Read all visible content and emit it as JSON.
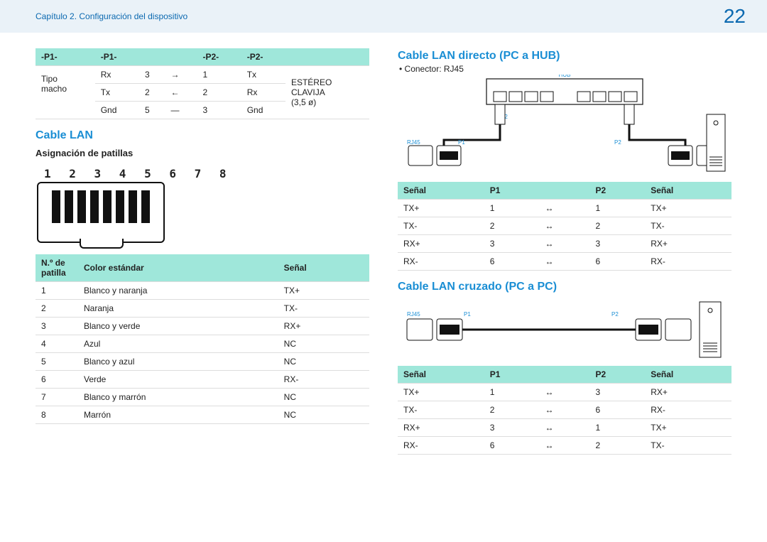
{
  "header": {
    "chapter": "Capítulo 2. Configuración del dispositivo",
    "page": "22"
  },
  "table1": {
    "headers": [
      "-P1-",
      "-P1-",
      "",
      "-P2-",
      "-P2-"
    ],
    "rows": [
      [
        "Tipo",
        "Rx",
        "3",
        "→",
        "1",
        "Tx",
        "ESTÉREO"
      ],
      [
        "macho",
        "Tx",
        "2",
        "←",
        "2",
        "Rx",
        "CLAVIJA"
      ],
      [
        "",
        "Gnd",
        "5",
        "—",
        "3",
        "Gnd",
        "(3,5 ø)"
      ]
    ]
  },
  "left": {
    "section": "Cable LAN",
    "subtitle": "Asignación de patillas",
    "pins": "1 2 3 4 5 6 7 8",
    "pinTable": {
      "headers": [
        "N.º de patilla",
        "Color estándar",
        "Señal"
      ],
      "rows": [
        [
          "1",
          "Blanco y naranja",
          "TX+"
        ],
        [
          "2",
          "Naranja",
          "TX-"
        ],
        [
          "3",
          "Blanco y verde",
          "RX+"
        ],
        [
          "4",
          "Azul",
          "NC"
        ],
        [
          "5",
          "Blanco y azul",
          "NC"
        ],
        [
          "6",
          "Verde",
          "RX-"
        ],
        [
          "7",
          "Blanco y marrón",
          "NC"
        ],
        [
          "8",
          "Marrón",
          "NC"
        ]
      ]
    }
  },
  "right": {
    "direct": {
      "title": "Cable LAN directo (PC a HUB)",
      "bullet": "•  Conector: RJ45",
      "labels": {
        "hub": "HUB",
        "p1": "P1",
        "p2": "P2",
        "rj45": "RJ45"
      },
      "tableHeaders": [
        "Señal",
        "P1",
        "",
        "P2",
        "Señal"
      ],
      "rows": [
        [
          "TX+",
          "1",
          "↔",
          "1",
          "TX+"
        ],
        [
          "TX-",
          "2",
          "↔",
          "2",
          "TX-"
        ],
        [
          "RX+",
          "3",
          "↔",
          "3",
          "RX+"
        ],
        [
          "RX-",
          "6",
          "↔",
          "6",
          "RX-"
        ]
      ]
    },
    "cross": {
      "title": "Cable LAN cruzado (PC a PC)",
      "labels": {
        "p1": "P1",
        "p2": "P2",
        "rj45": "RJ45"
      },
      "tableHeaders": [
        "Señal",
        "P1",
        "",
        "P2",
        "Señal"
      ],
      "rows": [
        [
          "TX+",
          "1",
          "↔",
          "3",
          "RX+"
        ],
        [
          "TX-",
          "2",
          "↔",
          "6",
          "RX-"
        ],
        [
          "RX+",
          "3",
          "↔",
          "1",
          "TX+"
        ],
        [
          "RX-",
          "6",
          "↔",
          "2",
          "TX-"
        ]
      ]
    }
  }
}
